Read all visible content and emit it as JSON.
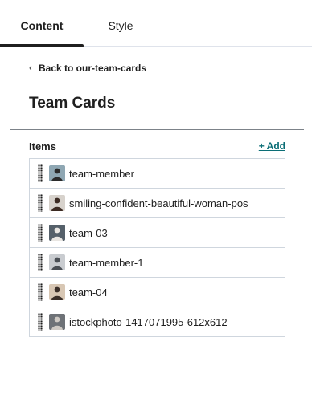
{
  "tabs": [
    {
      "label": "Content",
      "active": true
    },
    {
      "label": "Style",
      "active": false
    }
  ],
  "back_link": {
    "label": "Back to our-team-cards",
    "icon": "chevron-left-icon"
  },
  "title": "Team Cards",
  "items_section": {
    "label": "Items",
    "add_label": "+ Add",
    "accent_color": "#0b6e76",
    "items": [
      {
        "label": "team-member",
        "thumb_bg": "#8fa7b3",
        "thumb_fg": "#2b2b2b"
      },
      {
        "label": "smiling-confident-beautiful-woman-pos",
        "thumb_bg": "#d7d2cc",
        "thumb_fg": "#3b2a22"
      },
      {
        "label": "team-03",
        "thumb_bg": "#55606a",
        "thumb_fg": "#e9e6e2"
      },
      {
        "label": "team-member-1",
        "thumb_bg": "#c9ccd0",
        "thumb_fg": "#4a4f55"
      },
      {
        "label": "team-04",
        "thumb_bg": "#d8c7b4",
        "thumb_fg": "#3a2e28"
      },
      {
        "label": "istockphoto-1417071995-612x612",
        "thumb_bg": "#6e7277",
        "thumb_fg": "#cfcac4"
      }
    ]
  }
}
